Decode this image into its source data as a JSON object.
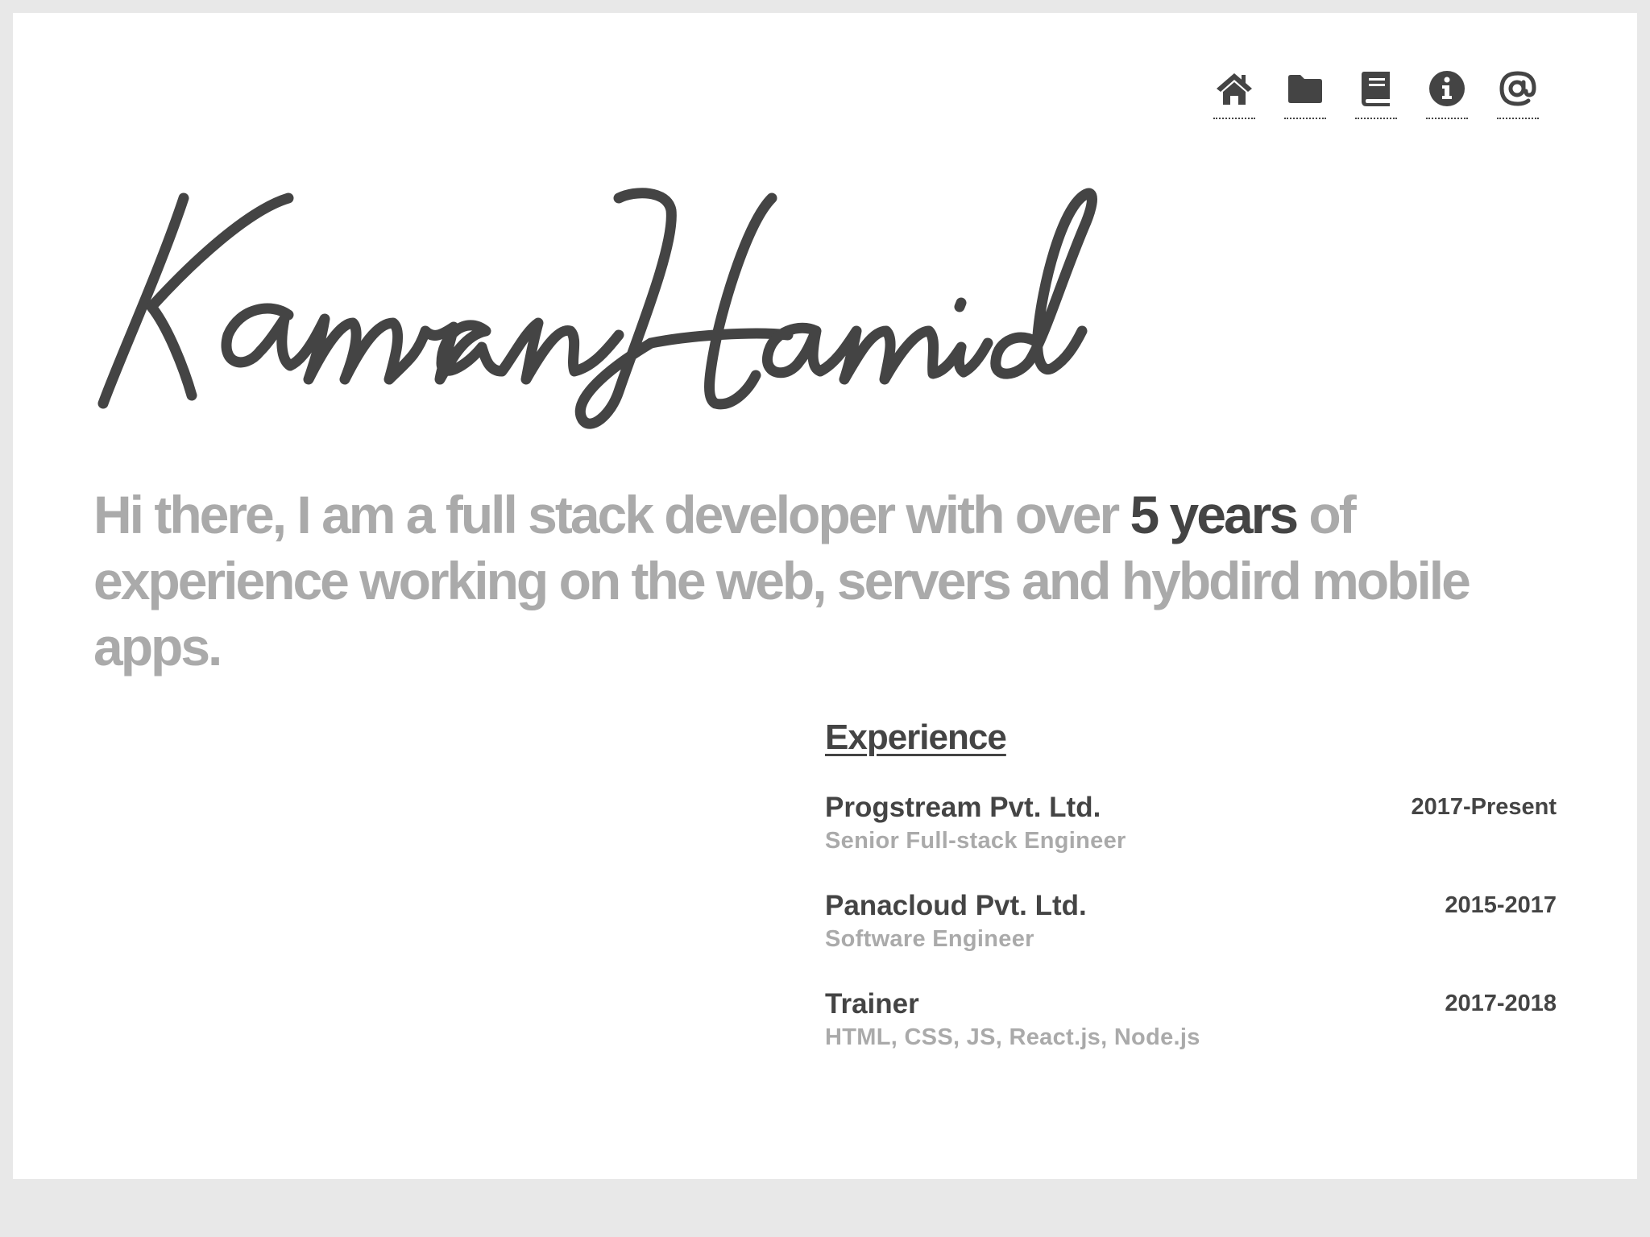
{
  "nav": {
    "items": [
      {
        "icon": "home-icon"
      },
      {
        "icon": "folder-icon"
      },
      {
        "icon": "book-icon"
      },
      {
        "icon": "info-icon"
      },
      {
        "icon": "at-icon"
      }
    ]
  },
  "hero": {
    "name": "Kamran Hamid",
    "intro_before": "Hi there, I am a full stack developer with over ",
    "intro_highlight": "5 years",
    "intro_after": " of experience working on the web, servers and hybdird mobile apps."
  },
  "experience": {
    "heading": "Experience",
    "jobs": [
      {
        "company": "Progstream Pvt. Ltd.",
        "role": "Senior Full-stack Engineer",
        "dates": "2017-Present"
      },
      {
        "company": "Panacloud Pvt. Ltd.",
        "role": "Software Engineer",
        "dates": "2015-2017"
      },
      {
        "company": "Trainer",
        "role": "HTML, CSS, JS, React.js, Node.js",
        "dates": "2017-2018"
      }
    ]
  },
  "colors": {
    "text": "#444444",
    "muted": "#aaaaaa",
    "background": "#e8e8e8",
    "card": "#ffffff"
  }
}
